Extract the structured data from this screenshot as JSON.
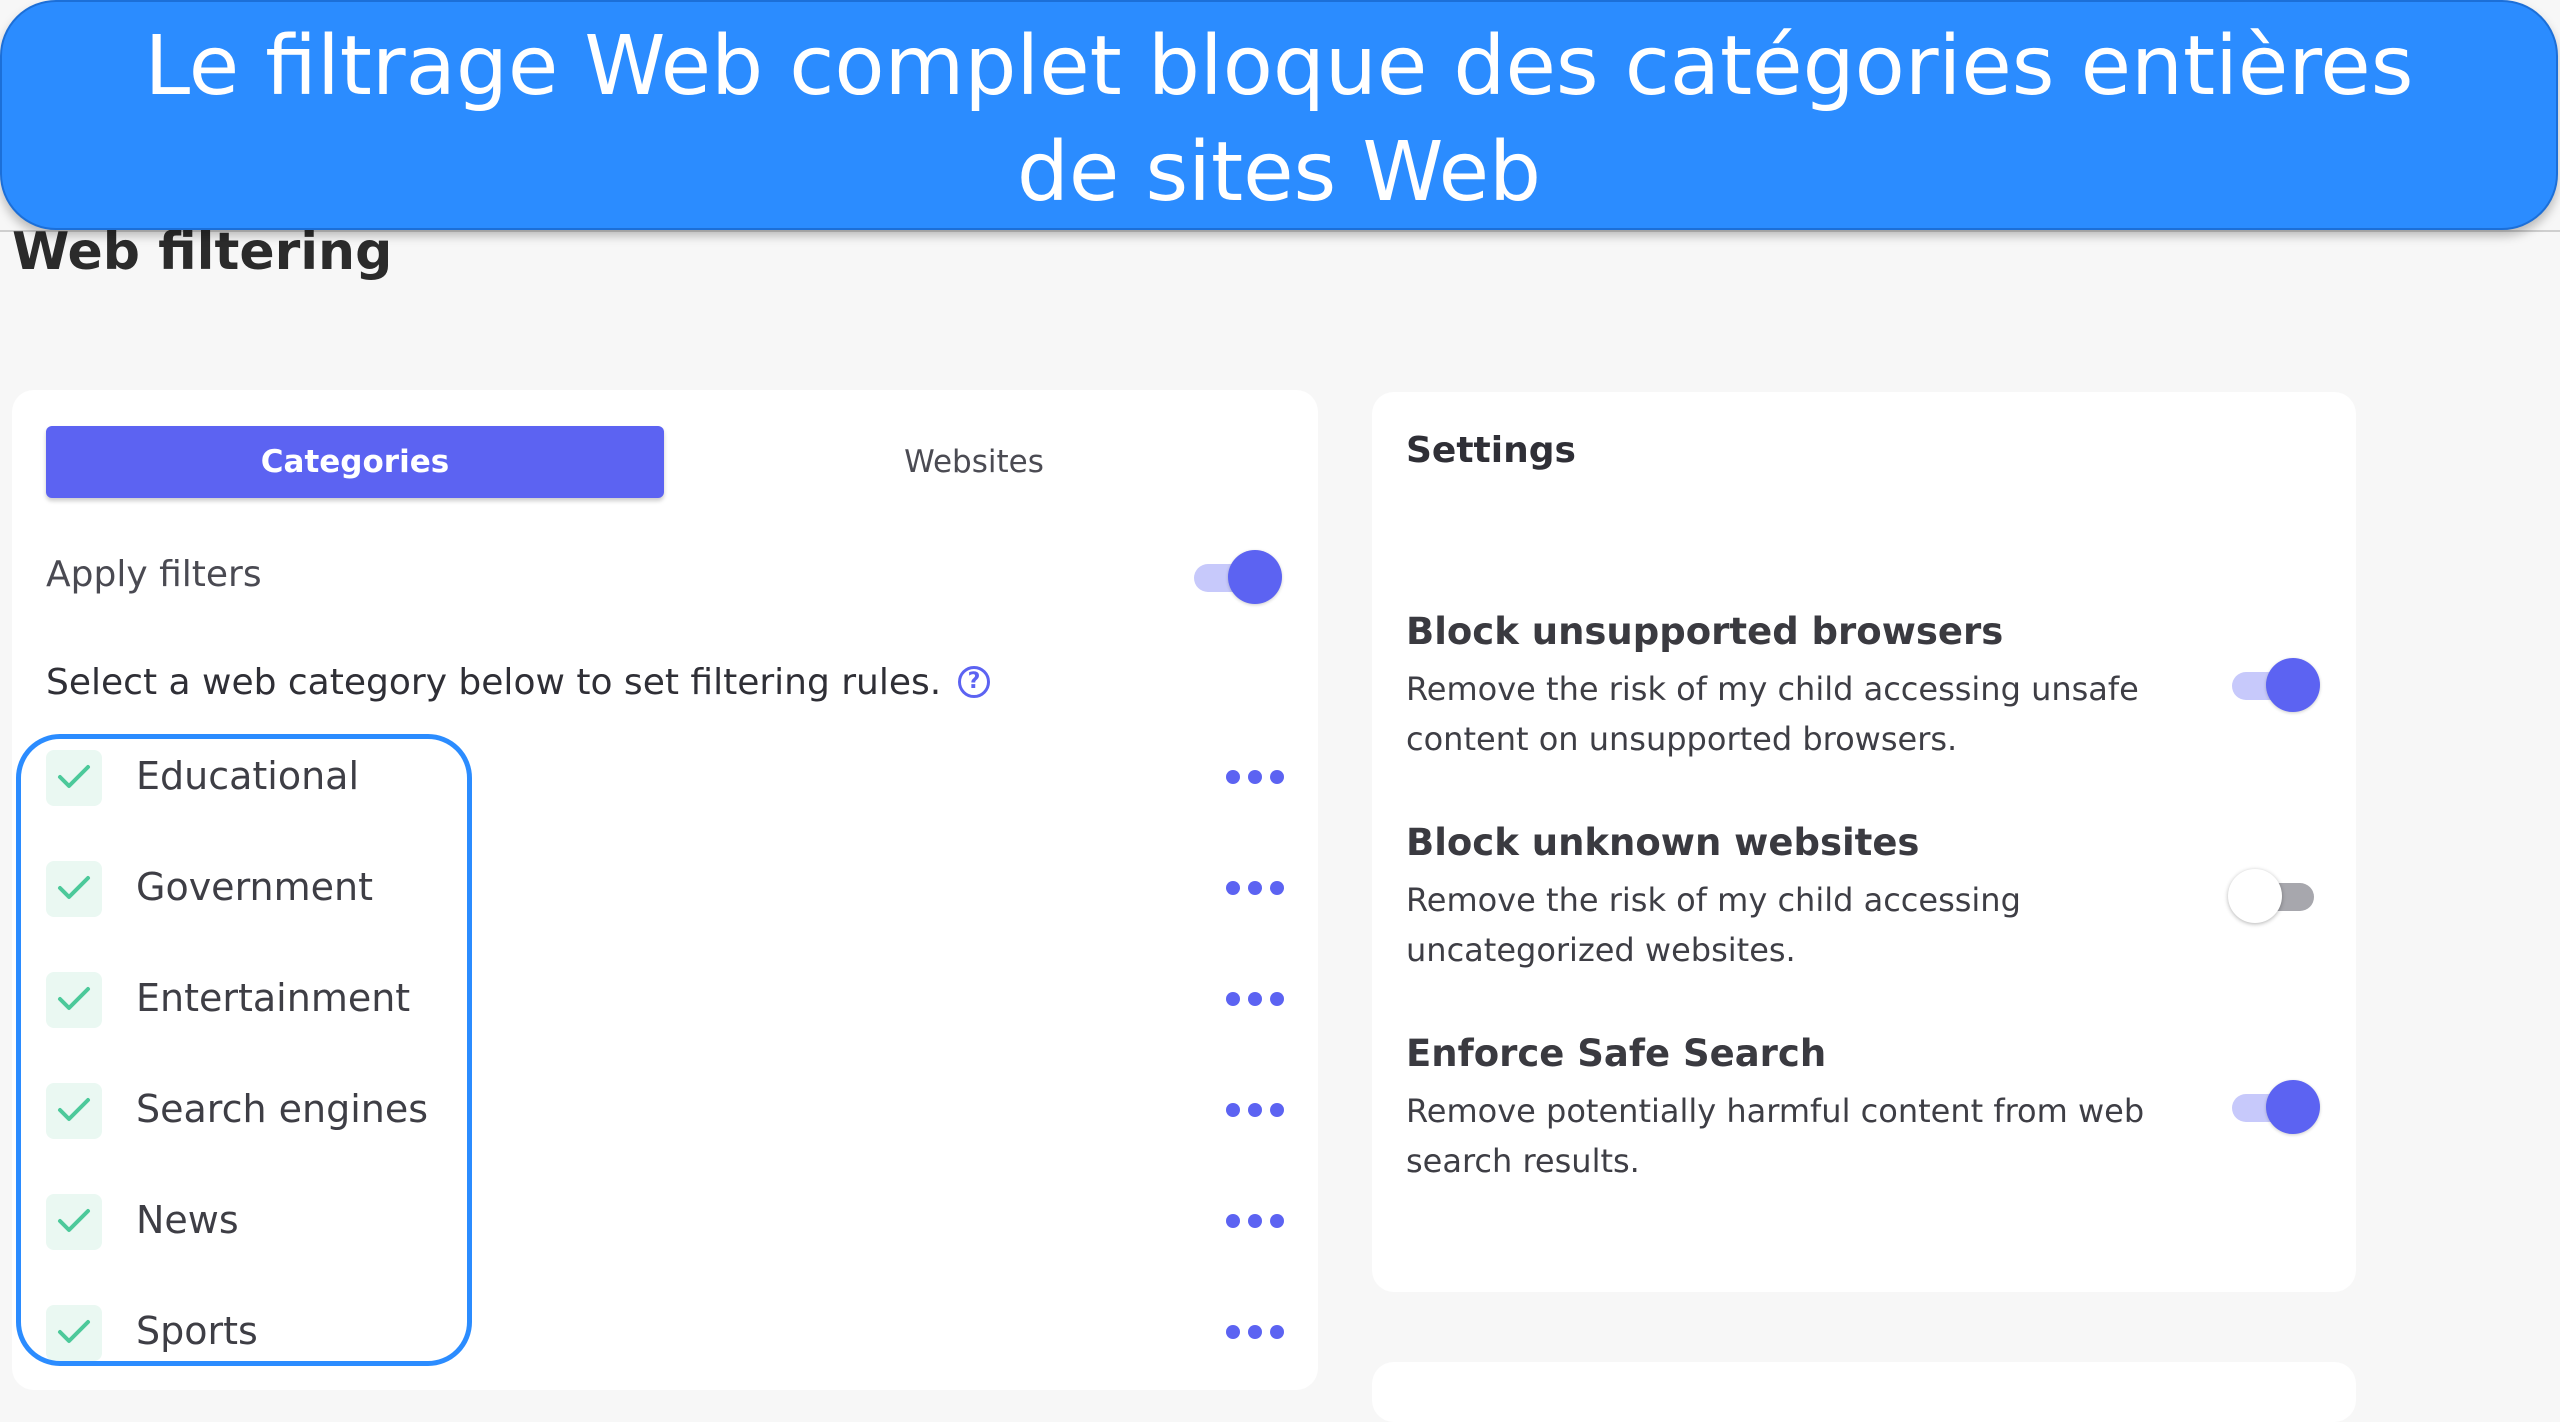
{
  "banner": {
    "line1": "Le filtrage Web complet bloque des catégories entières",
    "line2": "de sites Web"
  },
  "page": {
    "title": "Web filtering"
  },
  "tabs": [
    {
      "label": "Categories",
      "active": true
    },
    {
      "label": "Websites",
      "active": false
    }
  ],
  "apply_filters": {
    "label": "Apply filters",
    "enabled": true
  },
  "hint": "Select a web category below to set filtering rules.",
  "help_glyph": "?",
  "categories": [
    {
      "label": "Educational",
      "checked": true
    },
    {
      "label": "Government",
      "checked": true
    },
    {
      "label": "Entertainment",
      "checked": true
    },
    {
      "label": "Search engines",
      "checked": true
    },
    {
      "label": "News",
      "checked": true
    },
    {
      "label": "Sports",
      "checked": true
    }
  ],
  "settings": {
    "title": "Settings",
    "items": [
      {
        "title": "Block unsupported browsers",
        "desc_line1": "Remove the risk of my child accessing unsafe",
        "desc_line2": "content on unsupported browsers.",
        "enabled": true
      },
      {
        "title": "Block unknown websites",
        "desc_line1": "Remove the risk of my child accessing",
        "desc_line2": "uncategorized websites.",
        "enabled": false
      },
      {
        "title": "Enforce Safe Search",
        "desc_line1": "Remove potentially harmful content from web",
        "desc_line2": "search results.",
        "enabled": true
      }
    ]
  },
  "colors": {
    "banner": "#2b8cff",
    "accent": "#5c63f2",
    "check": "#4cc99a",
    "highlight": "#2b8cff"
  }
}
